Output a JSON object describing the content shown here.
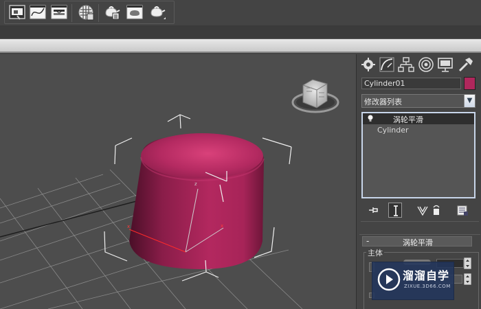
{
  "colors": {
    "viewport_bg": "#4d4d4d",
    "object_color": "#b0275c",
    "panel_bg": "#444444",
    "stack_border": "#c8d6ea",
    "watermark_bg": "#22365c"
  },
  "toolbar": {
    "icons": [
      "scene-explorer-icon",
      "curve-editor-icon",
      "schematic-view-icon",
      "material-editor-icon",
      "render-setup-icon",
      "rendered-frame-icon",
      "quick-render-icon"
    ]
  },
  "command_panel": {
    "tabs": [
      "create-tab",
      "modify-tab",
      "hierarchy-tab",
      "motion-tab",
      "display-tab",
      "utilities-tab"
    ],
    "object_name": "Cylinder01",
    "modifier_list": {
      "label": "修改器列表"
    },
    "stack": {
      "items": [
        {
          "label": "涡轮平滑",
          "selected": true
        },
        {
          "label": "Cylinder",
          "selected": false
        }
      ]
    },
    "rollout": {
      "title": "涡轮平滑",
      "collapse_symbol": "-",
      "group_label": "主体"
    }
  },
  "watermark": {
    "title": "溜溜自学",
    "subtitle": "ZIXUE.3D66.COM"
  }
}
